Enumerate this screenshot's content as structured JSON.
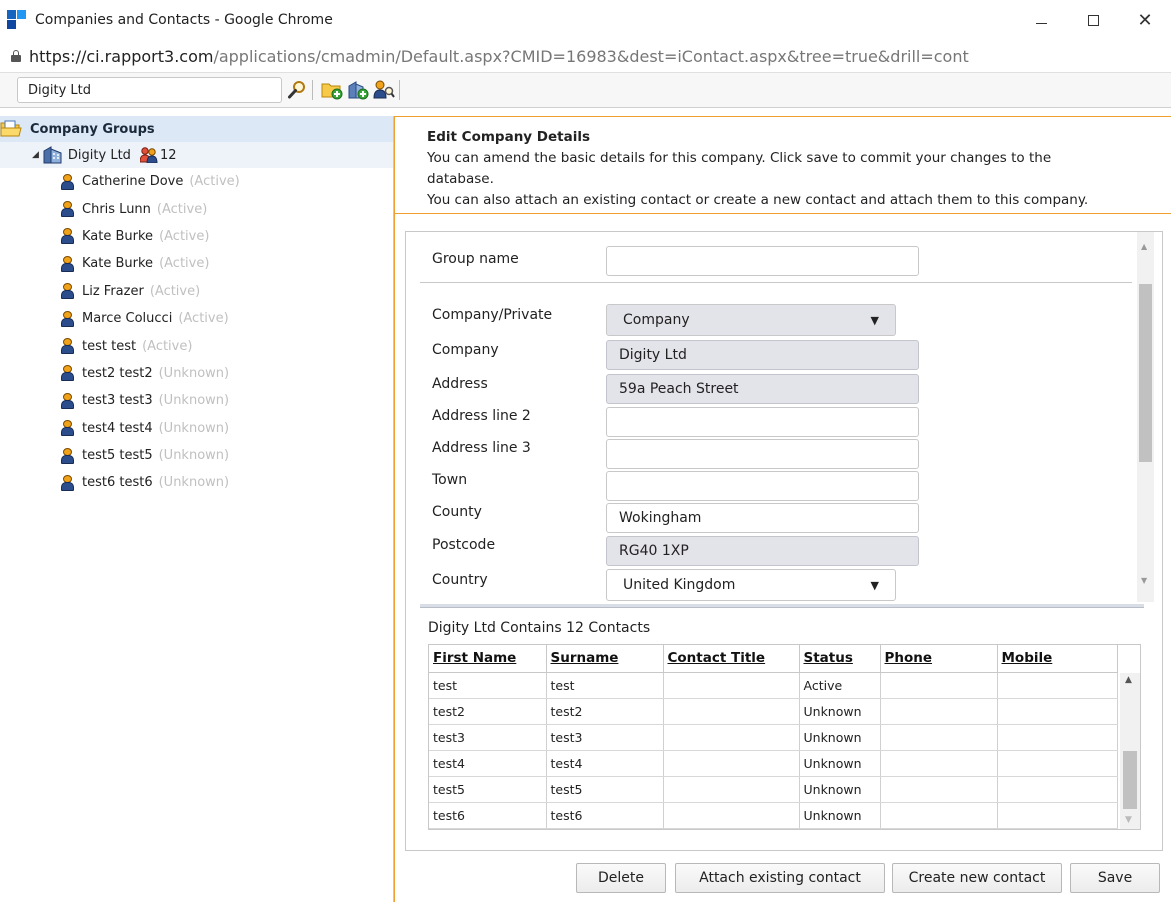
{
  "window": {
    "title": "Companies and Contacts - Google Chrome",
    "url_scheme_host": "https://ci.rapport3.com",
    "url_path": "/applications/cmadmin/Default.aspx?CMID=16983&dest=iContact.aspx&tree=true&drill=cont"
  },
  "toolbar": {
    "search_value": "Digity Ltd",
    "icons": [
      "search-icon",
      "add-folder-icon",
      "add-company-icon",
      "find-contact-icon"
    ]
  },
  "tree": {
    "root_label": "Company Groups",
    "company": {
      "name": "Digity Ltd",
      "contact_count": "12"
    },
    "contacts": [
      {
        "name": "Catherine Dove",
        "status": "(Active)"
      },
      {
        "name": "Chris Lunn",
        "status": "(Active)"
      },
      {
        "name": "Kate Burke",
        "status": "(Active)"
      },
      {
        "name": "Kate Burke",
        "status": "(Active)"
      },
      {
        "name": "Liz Frazer",
        "status": "(Active)"
      },
      {
        "name": "Marce Colucci",
        "status": "(Active)"
      },
      {
        "name": "test test",
        "status": "(Active)"
      },
      {
        "name": "test2 test2",
        "status": "(Unknown)"
      },
      {
        "name": "test3 test3",
        "status": "(Unknown)"
      },
      {
        "name": "test4 test4",
        "status": "(Unknown)"
      },
      {
        "name": "test5 test5",
        "status": "(Unknown)"
      },
      {
        "name": "test6 test6",
        "status": "(Unknown)"
      }
    ]
  },
  "info": {
    "heading": "Edit Company Details",
    "line1": "You can amend the basic details for this company. Click save to commit your changes to the",
    "line2": "database.",
    "line3": "You can also attach an existing contact or create a new contact and attach them to this company."
  },
  "form": {
    "group_name": {
      "label": "Group name",
      "value": ""
    },
    "company_private": {
      "label": "Company/Private",
      "value": "Company"
    },
    "company": {
      "label": "Company",
      "value": "Digity Ltd"
    },
    "address": {
      "label": "Address",
      "value": "59a Peach Street"
    },
    "address2": {
      "label": "Address line 2",
      "value": ""
    },
    "address3": {
      "label": "Address line 3",
      "value": ""
    },
    "town": {
      "label": "Town",
      "value": ""
    },
    "county": {
      "label": "County",
      "value": "Wokingham"
    },
    "postcode": {
      "label": "Postcode",
      "value": "RG40 1XP"
    },
    "country": {
      "label": "Country",
      "value": "United Kingdom"
    }
  },
  "contacts_grid": {
    "caption": "Digity Ltd Contains 12 Contacts",
    "columns": [
      "First Name",
      "Surname",
      "Contact Title",
      "Status",
      "Phone",
      "Mobile"
    ],
    "rows": [
      [
        "test",
        "test",
        "",
        "Active",
        "",
        ""
      ],
      [
        "test2",
        "test2",
        "",
        "Unknown",
        "",
        ""
      ],
      [
        "test3",
        "test3",
        "",
        "Unknown",
        "",
        ""
      ],
      [
        "test4",
        "test4",
        "",
        "Unknown",
        "",
        ""
      ],
      [
        "test5",
        "test5",
        "",
        "Unknown",
        "",
        ""
      ],
      [
        "test6",
        "test6",
        "",
        "Unknown",
        "",
        ""
      ]
    ]
  },
  "buttons": {
    "delete": "Delete",
    "attach": "Attach existing contact",
    "create": "Create new contact",
    "save": "Save"
  }
}
